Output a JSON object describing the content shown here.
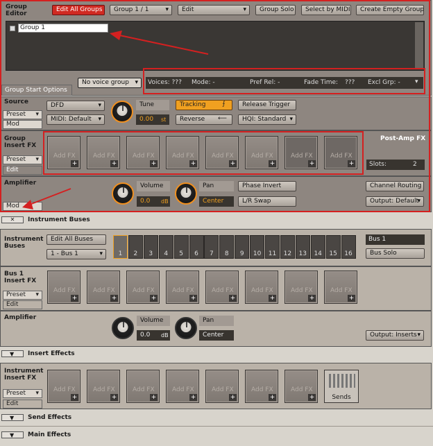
{
  "group_editor": {
    "title": "Group Editor",
    "edit_all_groups": "Edit All Groups",
    "group_select": "Group 1 / 1",
    "edit_menu": "Edit",
    "group_solo": "Group Solo",
    "select_by_midi": "Select by MIDI",
    "create_empty_group": "Create Empty Group",
    "group_name": "Group 1",
    "no_voice_group": "No voice group",
    "voices": "Voices: ???",
    "mode": "Mode: -",
    "pref_rel": "Pref Rel: -",
    "fade_time_label": "Fade Time:",
    "fade_time_val": "???",
    "excl_grp": "Excl Grp: -",
    "group_start_options": "Group Start Options"
  },
  "source": {
    "title": "Source",
    "preset": "Preset",
    "mod": "Mod",
    "mode": "DFD",
    "midi": "MIDI: Default",
    "tune_label": "Tune",
    "tune_val": "0.00",
    "tune_unit": "st",
    "tracking": "Tracking",
    "reverse": "Reverse",
    "release_trigger": "Release Trigger",
    "hqi": "HQI: Standard"
  },
  "group_insert_fx": {
    "title": "Group Insert FX",
    "preset": "Preset",
    "edit": "Edit",
    "slot_label": "Add FX",
    "post_amp": "Post-Amp FX",
    "slots_label": "Slots:",
    "slots_val": "2"
  },
  "amplifier": {
    "title": "Amplifier",
    "mod": "Mod",
    "volume_label": "Volume",
    "volume_val": "0.0",
    "volume_unit": "dB",
    "pan_label": "Pan",
    "pan_val": "Center",
    "phase_invert": "Phase Invert",
    "lr_swap": "L/R Swap",
    "channel_routing": "Channel Routing",
    "output": "Output: Default"
  },
  "instrument_buses": {
    "header": "Instrument Buses",
    "title": "Instrument Buses",
    "edit_all_buses": "Edit All Buses",
    "bus_select": "1 - Bus 1",
    "bus_numbers": [
      "1",
      "2",
      "3",
      "4",
      "5",
      "6",
      "7",
      "8",
      "9",
      "10",
      "11",
      "12",
      "13",
      "14",
      "15",
      "16"
    ],
    "bus_name": "Bus 1",
    "bus_solo": "Bus Solo",
    "insert_title": "Bus 1 Insert FX",
    "preset": "Preset",
    "edit": "Edit",
    "amp_title": "Amplifier",
    "volume_label": "Volume",
    "volume_val": "0.0",
    "volume_unit": "dB",
    "pan_label": "Pan",
    "pan_val": "Center",
    "output": "Output: Inserts"
  },
  "insert_effects": {
    "header": "Insert Effects",
    "title": "Instrument Insert FX",
    "preset": "Preset",
    "edit": "Edit",
    "sends": "Sends"
  },
  "send_effects": {
    "header": "Send Effects"
  },
  "main_effects": {
    "header": "Main Effects"
  },
  "colors": {
    "accent_red": "#d02a22",
    "orange": "#f0a020",
    "panel": "#8e8680"
  }
}
